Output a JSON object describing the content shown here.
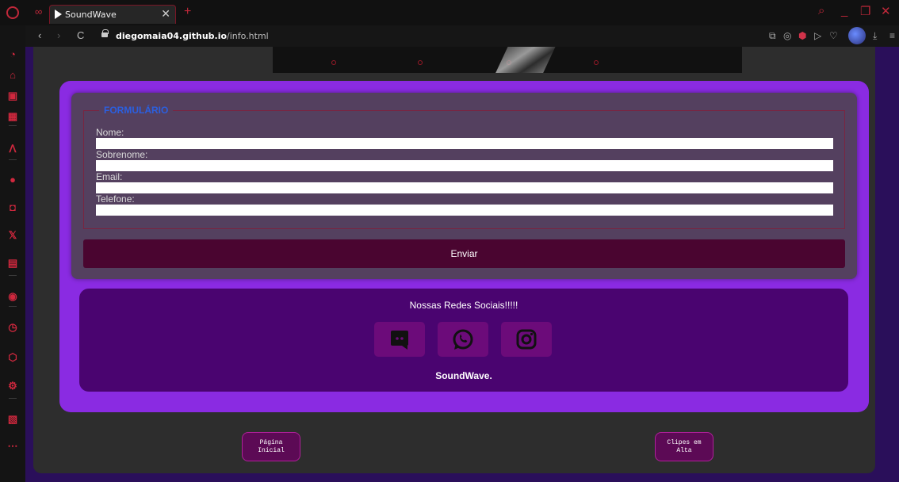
{
  "browser": {
    "tab_title": "SoundWave",
    "tab_close": "✕",
    "tab_new": "+",
    "url_host": "diegomaia04.github.io",
    "url_path": "/info.html",
    "nav_back": "‹",
    "nav_forward": "›",
    "nav_reload": "C",
    "win_search": "⌕",
    "win_min": "_",
    "win_max": "❐",
    "win_close": "✕",
    "tools": [
      "⧉",
      "◎",
      "⬢",
      "▷",
      "♡",
      "⤓",
      "≡"
    ]
  },
  "sidebar": {
    "icons": [
      "speed-dial-icon",
      "bag-icon",
      "twitch-icon",
      "chip-icon",
      "aria-icon",
      "messenger-icon",
      "instagram-icon",
      "x-icon",
      "discord-icon",
      "player-icon",
      "history-icon",
      "box-icon",
      "settings-icon",
      "wallet-icon",
      "more-icon"
    ],
    "glyphs": [
      "◔",
      "⌂",
      "▣",
      "▦",
      "ᐱ",
      "●",
      "◘",
      "𝕏",
      "▤",
      "◉",
      "◷",
      "⬡",
      "⚙",
      "▧",
      "⋯"
    ]
  },
  "form": {
    "legend": "FORMULÁRIO",
    "fields": [
      {
        "label": "Nome:",
        "value": ""
      },
      {
        "label": "Sobrenome:",
        "value": ""
      },
      {
        "label": "Email:",
        "value": ""
      },
      {
        "label": "Telefone:",
        "value": ""
      }
    ],
    "submit_label": "Enviar"
  },
  "social": {
    "title": "Nossas Redes Sociais!!!!!",
    "buttons": [
      "discord-icon",
      "whatsapp-icon",
      "instagram-icon"
    ],
    "brand": "SoundWave."
  },
  "nav": {
    "home_line1": "Página",
    "home_line2": "Inicial",
    "clips_line1": "Clipes em",
    "clips_line2": "Alta"
  },
  "colors": {
    "accent_purple": "#8a2be2",
    "form_bg": "#54405f",
    "submit_bg": "#4a0530",
    "social_bg": "#4a0470",
    "legend": "#2b5fe0",
    "browser_red": "#c0283a"
  }
}
